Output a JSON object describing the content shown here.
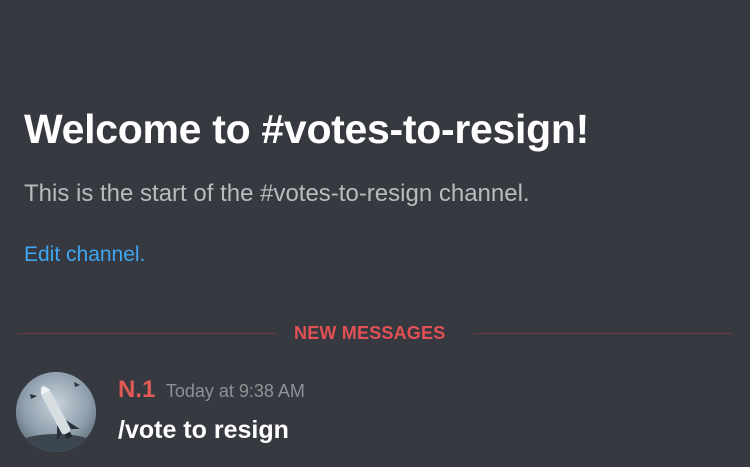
{
  "channel": {
    "welcome_title": "Welcome to #votes-to-resign!",
    "welcome_description": "This is the start of the #votes-to-resign channel.",
    "edit_link": "Edit channel."
  },
  "divider": {
    "label": "NEW MESSAGES"
  },
  "message": {
    "avatar_icon": "rocket-avatar-icon",
    "username": "N.1",
    "timestamp": "Today at 9:38 AM",
    "content": "/vote to resign"
  },
  "colors": {
    "background": "#36393f",
    "title": "#ffffff",
    "description": "#b9bbbe",
    "link": "#3ea6f2",
    "new_messages": "#e25155",
    "username": "#e25a55",
    "timestamp": "#8e9297"
  }
}
